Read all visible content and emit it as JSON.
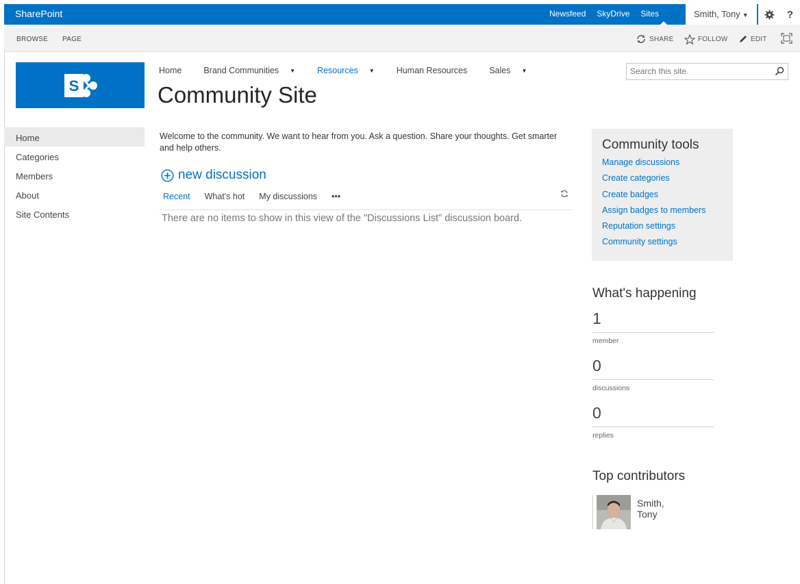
{
  "suitebar": {
    "brand": "SharePoint",
    "links": [
      "Newsfeed",
      "SkyDrive",
      "Sites"
    ],
    "user": "Smith, Tony",
    "help": "?",
    "colors": {
      "bar": "#0072c6"
    }
  },
  "ribbon": {
    "tabs": [
      "BROWSE",
      "PAGE"
    ],
    "actions": {
      "share": "SHARE",
      "follow": "FOLLOW",
      "edit": "EDIT"
    }
  },
  "topnav": {
    "items": [
      {
        "label": "Home",
        "has_dropdown": false
      },
      {
        "label": "Brand Communities",
        "has_dropdown": true
      },
      {
        "label": "Resources",
        "has_dropdown": true,
        "selected": true
      },
      {
        "label": "Human Resources",
        "has_dropdown": false
      },
      {
        "label": "Sales",
        "has_dropdown": true
      }
    ]
  },
  "site": {
    "title": "Community Site"
  },
  "search": {
    "placeholder": "Search this site"
  },
  "leftnav": {
    "items": [
      "Home",
      "Categories",
      "Members",
      "About",
      "Site Contents"
    ],
    "selected": "Home"
  },
  "main": {
    "welcome": "Welcome to the community. We want to hear from you. Ask a question. Share your thoughts. Get smarter and help others.",
    "new_discussion": "new discussion",
    "views": [
      "Recent",
      "What's hot",
      "My discussions"
    ],
    "more": "•••",
    "empty_message": "There are no items to show in this view of the \"Discussions List\" discussion board."
  },
  "tools": {
    "title": "Community tools",
    "links": [
      "Manage discussions",
      "Create categories",
      "Create badges",
      "Assign badges to members",
      "Reputation settings",
      "Community settings"
    ]
  },
  "whats_happening": {
    "title": "What's happening",
    "stats": [
      {
        "value": "1",
        "label": "member"
      },
      {
        "value": "0",
        "label": "discussions"
      },
      {
        "value": "0",
        "label": "replies"
      }
    ]
  },
  "top_contributors": {
    "title": "Top contributors",
    "people": [
      {
        "name": "Smith, Tony"
      }
    ]
  }
}
